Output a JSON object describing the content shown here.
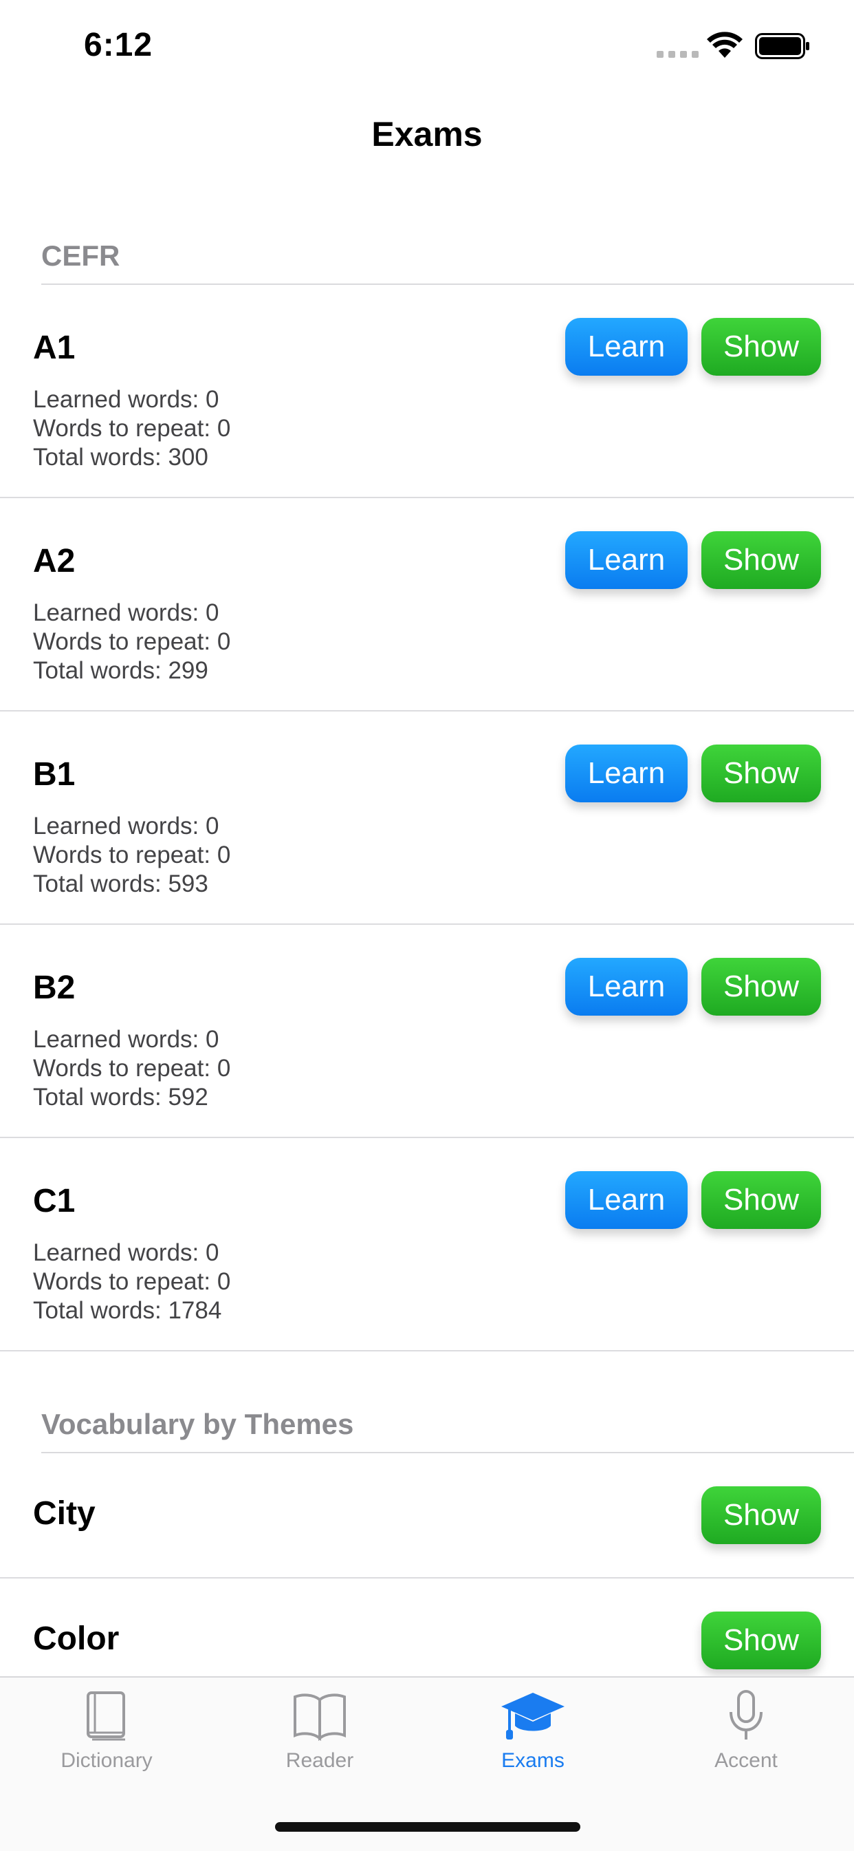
{
  "status_bar": {
    "time": "6:12"
  },
  "nav": {
    "title": "Exams"
  },
  "sections": {
    "cefr": {
      "header": "CEFR"
    },
    "themes": {
      "header": "Vocabulary by Themes"
    }
  },
  "labels": {
    "learned": "Learned words: 0",
    "repeat": "Words to repeat: 0",
    "learn_button": "Learn",
    "show_button": "Show"
  },
  "cefr_levels": [
    {
      "title": "A1",
      "learned": "Learned words: 0",
      "repeat": "Words to repeat: 0",
      "total": "Total words: 300"
    },
    {
      "title": "A2",
      "learned": "Learned words: 0",
      "repeat": "Words to repeat: 0",
      "total": "Total words: 299"
    },
    {
      "title": "B1",
      "learned": "Learned words: 0",
      "repeat": "Words to repeat: 0",
      "total": "Total words: 593"
    },
    {
      "title": "B2",
      "learned": "Learned words: 0",
      "repeat": "Words to repeat: 0",
      "total": "Total words: 592"
    },
    {
      "title": "C1",
      "learned": "Learned words: 0",
      "repeat": "Words to repeat: 0",
      "total": "Total words: 1784"
    }
  ],
  "themes": [
    {
      "title": "City"
    },
    {
      "title": "Color"
    }
  ],
  "tab_bar": {
    "tabs": [
      {
        "label": "Dictionary",
        "icon": "book-icon"
      },
      {
        "label": "Reader",
        "icon": "open-book-icon"
      },
      {
        "label": "Exams",
        "icon": "graduation-cap-icon"
      },
      {
        "label": "Accent",
        "icon": "microphone-icon"
      }
    ],
    "active": "Exams"
  },
  "colors": {
    "learn_button": "#0a7cf0",
    "show_button": "#1faa22",
    "tab_active": "#1a7cf0",
    "tab_inactive": "#9a9a9d"
  }
}
